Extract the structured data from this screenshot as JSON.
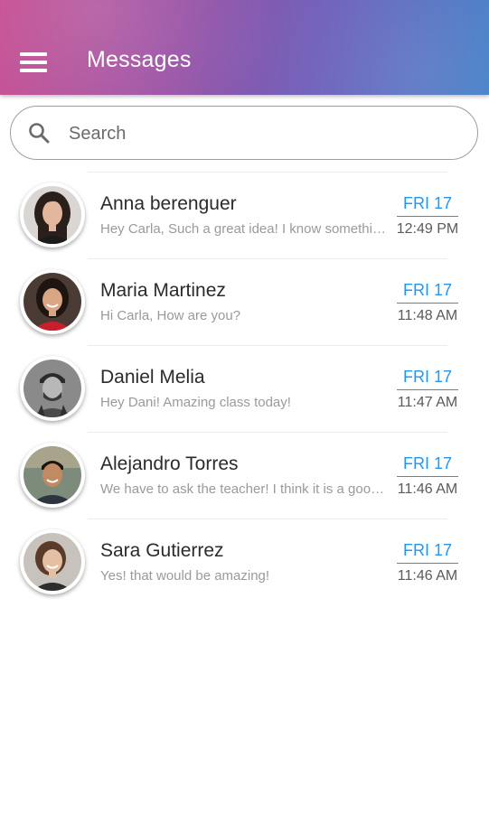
{
  "header": {
    "title": "Messages",
    "menu_icon": "hamburger-menu-icon",
    "gradient_colors": [
      "#c54b8f",
      "#9a4fa3",
      "#6a5bb8",
      "#3f7cc6"
    ]
  },
  "search": {
    "placeholder": "Search",
    "value": "",
    "icon": "search-icon"
  },
  "accent_color": "#2196f3",
  "conversations": [
    {
      "name": "Anna berenguer",
      "preview": "Hey Carla,  Such a great idea! I know something you will love",
      "date": "FRI 17",
      "time": "12:49 PM"
    },
    {
      "name": "Maria Martinez",
      "preview": "Hi Carla, How are you?",
      "date": "FRI 17",
      "time": "11:48 AM"
    },
    {
      "name": "Daniel Melia",
      "preview": "Hey Dani! Amazing class today!",
      "date": "FRI 17",
      "time": "11:47 AM"
    },
    {
      "name": "Alejandro Torres",
      "preview": "We have to ask the teacher! I think it is a good idea",
      "date": "FRI 17",
      "time": "11:46 AM"
    },
    {
      "name": "Sara Gutierrez",
      "preview": "Yes! that would be amazing!",
      "date": "FRI 17",
      "time": "11:46 AM"
    }
  ]
}
